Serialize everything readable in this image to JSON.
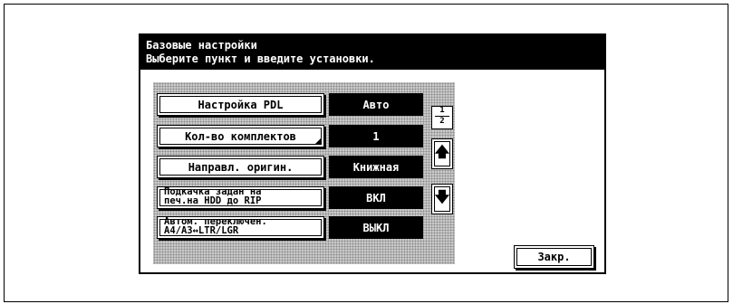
{
  "header": {
    "title": "Базовые настройки",
    "subtitle": "Выберите пункт и введите установки."
  },
  "settings": [
    {
      "label_line1": "Настройка PDL",
      "label_line2": "",
      "value": "Авто",
      "has_detail_mark": false
    },
    {
      "label_line1": "Кол-во комплектов",
      "label_line2": "",
      "value": "1",
      "has_detail_mark": true
    },
    {
      "label_line1": "Направл. оригин.",
      "label_line2": "",
      "value": "Книжная",
      "has_detail_mark": false
    },
    {
      "label_line1": "Подкачка задан на",
      "label_line2": "печ.на HDD до RIP",
      "value": "ВКЛ",
      "has_detail_mark": false
    },
    {
      "label_line1": "Автом. переключен.",
      "label_line2": "A4/A3↔LTR/LGR",
      "value": "ВЫКЛ",
      "has_detail_mark": false
    }
  ],
  "pagination": {
    "current": "1",
    "total": "2"
  },
  "scroll": {
    "up_icon": "arrow-up-icon",
    "down_icon": "arrow-down-icon",
    "up_glyph": "🡅",
    "down_glyph": "🡇"
  },
  "footer": {
    "close_label": "Закр."
  }
}
